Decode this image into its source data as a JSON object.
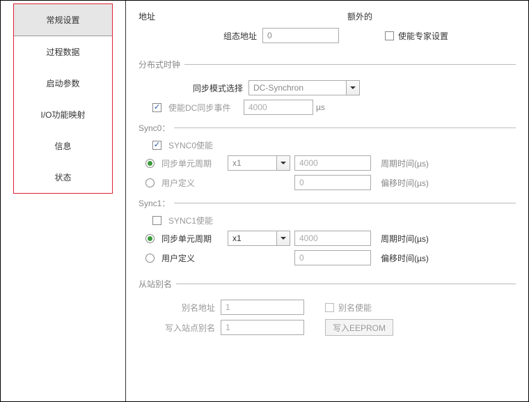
{
  "nav": {
    "items": [
      {
        "label": "常规设置"
      },
      {
        "label": "过程数据"
      },
      {
        "label": "启动参数"
      },
      {
        "label": "I/O功能映射"
      },
      {
        "label": "信息"
      },
      {
        "label": "状态"
      }
    ]
  },
  "addr": {
    "heading": "地址",
    "extra_heading": "额外的",
    "config_addr_label": "组态地址",
    "config_addr_value": "0",
    "expert_checkbox_label": "使能专家设置",
    "expert_checked": false
  },
  "dc": {
    "section_title": "分布式时钟",
    "sync_mode_label": "同步模式选择",
    "sync_mode_value": "DC-Synchron",
    "enable_dc_label": "使能DC同步事件",
    "enable_dc_checked": true,
    "enable_dc_value": "4000",
    "enable_dc_unit": "µs",
    "sync0": {
      "title": "Sync0：",
      "enable_label": "SYNC0使能",
      "enable_checked": true,
      "unit_period_label": "同步单元周期",
      "unit_period_selected": true,
      "unit_period_mult": "x1",
      "unit_period_value": "4000",
      "period_time_label": "周期时间(µs)",
      "user_def_label": "用户定义",
      "user_def_selected": false,
      "user_def_value": "0",
      "offset_time_label": "偏移时间(µs)"
    },
    "sync1": {
      "title": "Sync1：",
      "enable_label": "SYNC1使能",
      "enable_checked": false,
      "unit_period_label": "同步单元周期",
      "unit_period_selected": true,
      "unit_period_mult": "x1",
      "unit_period_value": "4000",
      "period_time_label": "周期时间(µs)",
      "user_def_label": "用户定义",
      "user_def_selected": false,
      "user_def_value": "0",
      "offset_time_label": "偏移时间(µs)"
    }
  },
  "alias": {
    "section_title": "从站别名",
    "alias_addr_label": "别名地址",
    "alias_addr_value": "1",
    "alias_enable_label": "别名使能",
    "alias_enable_checked": false,
    "write_alias_label": "写入站点别名",
    "write_alias_value": "1",
    "write_eeprom_btn": "写入EEPROM"
  }
}
